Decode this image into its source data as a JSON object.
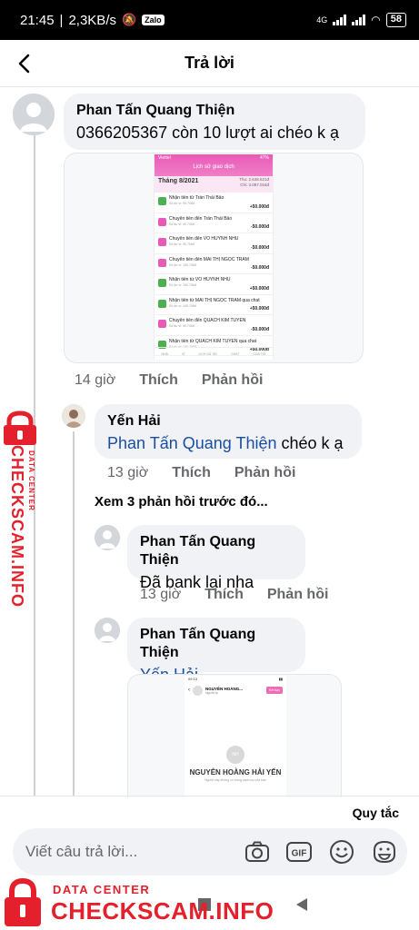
{
  "status_bar": {
    "time": "21:45",
    "speed": "2,3KB/s",
    "app_badge": "Zalo",
    "network": "4G",
    "battery": "58"
  },
  "header": {
    "title": "Trả lời"
  },
  "comment": {
    "author": "Phan Tấn Quang Thiện",
    "text": "0366205367 còn 10 lượt ai chéo k ạ",
    "time": "14 giờ",
    "like_label": "Thích",
    "reply_label": "Phản hồi"
  },
  "bank_screenshot": {
    "status_left": "Viettel",
    "status_right": "47%",
    "title": "Lịch sử giao dịch",
    "month": "Tháng 8/2021",
    "sum_in": "Thu: 2.648.621đ",
    "sum_out": "Chi: 3.087.016đ",
    "transactions": [
      {
        "desc": "Nhận tiền từ Trần Thái Bảo",
        "sub": "Số dư ví: 90.706đ",
        "amount": "+50.000đ",
        "dir": "in"
      },
      {
        "desc": "Chuyển tiền đến Trần Thái Bảo",
        "sub": "Số dư ví: 40.706đ",
        "amount": "-50.000đ",
        "dir": "out"
      },
      {
        "desc": "Chuyển tiền đến VO HUYNH NHU",
        "sub": "Số dư ví: 90.706đ",
        "amount": "-50.000đ",
        "dir": "out"
      },
      {
        "desc": "Chuyển tiền đến MAI THỊ NGỌC TRÂM",
        "sub": "Số dư ví: 140.706đ",
        "amount": "-50.000đ",
        "dir": "out"
      },
      {
        "desc": "Nhận tiền từ VO HUYNH NHU",
        "sub": "Số dư ví: 190.706đ",
        "amount": "+50.000đ",
        "dir": "in"
      },
      {
        "desc": "Nhận tiền từ MAI THỊ NGỌC TRÂM qua chat",
        "sub": "Số dư ví: 140.706đ",
        "amount": "+50.000đ",
        "dir": "in"
      },
      {
        "desc": "Chuyển tiền đến QUACH KIM TUYEN",
        "sub": "Số dư ví: 90.706đ",
        "amount": "-50.000đ",
        "dir": "out"
      },
      {
        "desc": "Nhận tiền từ QUACH KIM TUYEN qua chat",
        "sub": "Số dư ví: 140.706đ",
        "amount": "+50.000đ",
        "dir": "in"
      }
    ],
    "nav": [
      "NHÀ",
      "VÍ",
      "LỊCH SỬ GD",
      "CHAT",
      "CỦA TÔI"
    ]
  },
  "reply1": {
    "author": "Yến Hải",
    "mention": "Phan Tấn Quang Thiện",
    "text": " chéo k ạ",
    "time": "13 giờ",
    "like_label": "Thích",
    "reply_label": "Phản hồi"
  },
  "more_replies": "Xem 3 phản hồi trước đó...",
  "reply2": {
    "author": "Phan Tấn Quang Thiện",
    "text": "Đã bank lại nha",
    "time": "13 giờ",
    "like_label": "Thích",
    "reply_label": "Phản hồi"
  },
  "reply3": {
    "author": "Phan Tấn Quang Thiện",
    "mention": "Yến Hải"
  },
  "profile_screenshot": {
    "status_left": "09:13",
    "header_name": "NGUYỄN HOÀNG...",
    "header_sub": "Người lạ",
    "add_button": "Kết bạn",
    "avatar_initials": "NH",
    "name": "NGUYỄN HOÀNG HẢI YẾN",
    "subtitle": "Người này không có trong danh bạ của bạn"
  },
  "composer": {
    "rules_label": "Quy tắc",
    "placeholder": "Viết câu trả lời...",
    "gif_label": "GIF"
  },
  "watermark": {
    "side_big": "CHECKSCAM.INFO",
    "side_small": "DATA CENTER",
    "bottom_small": "DATA CENTER",
    "bottom_big": "CHECKSCAM.INFO"
  },
  "colors": {
    "accent_link": "#1a4fa0",
    "bubble": "#f0f2f5",
    "watermark_red": "#e3202b",
    "bank_pink": "#e85ab7"
  }
}
